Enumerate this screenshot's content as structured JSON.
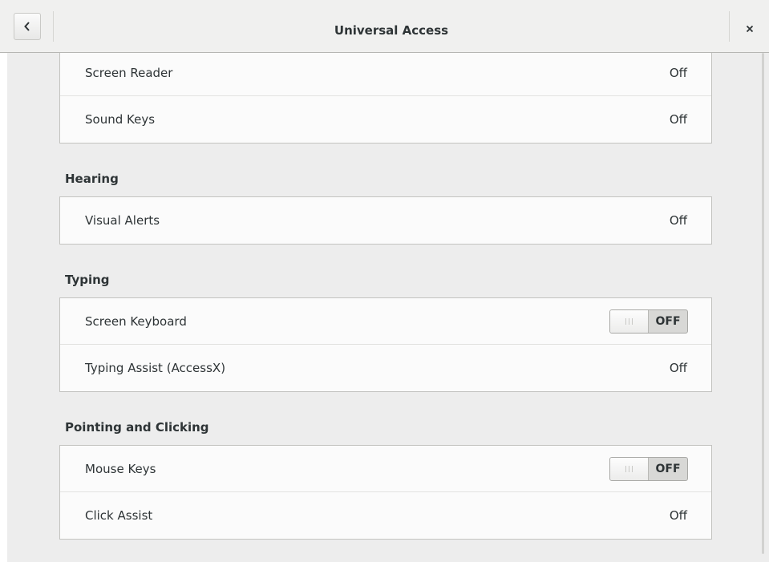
{
  "window": {
    "title": "Universal Access",
    "back_icon": "chevron-left-icon",
    "close_icon": "close-icon"
  },
  "seeing": {
    "rows": [
      {
        "label": "Screen Reader",
        "value": "Off"
      },
      {
        "label": "Sound Keys",
        "value": "Off"
      }
    ]
  },
  "hearing": {
    "title": "Hearing",
    "rows": [
      {
        "label": "Visual Alerts",
        "value": "Off"
      }
    ]
  },
  "typing": {
    "title": "Typing",
    "rows": [
      {
        "label": "Screen Keyboard",
        "switch_state": "OFF"
      },
      {
        "label": "Typing Assist (AccessX)",
        "value": "Off"
      }
    ]
  },
  "pointing": {
    "title": "Pointing and Clicking",
    "rows": [
      {
        "label": "Mouse Keys",
        "switch_state": "OFF"
      },
      {
        "label": "Click Assist",
        "value": "Off"
      }
    ]
  },
  "colors": {
    "background": "#ededed",
    "row_background": "#fbfbfb",
    "text": "#2e3436"
  }
}
